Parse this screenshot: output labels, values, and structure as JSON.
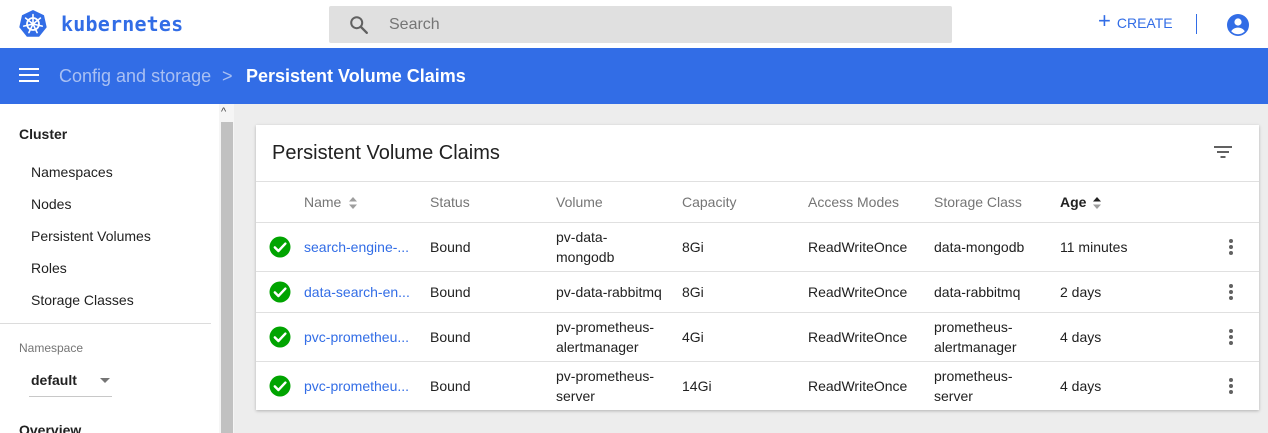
{
  "app": {
    "name": "kubernetes",
    "brand_color": "#326de6"
  },
  "search": {
    "placeholder": "Search"
  },
  "topbar": {
    "create_label": "CREATE"
  },
  "breadcrumb": {
    "parent": "Config and storage",
    "separator": ">",
    "current": "Persistent Volume Claims"
  },
  "sidebar": {
    "section": "Cluster",
    "items": [
      {
        "label": "Namespaces"
      },
      {
        "label": "Nodes"
      },
      {
        "label": "Persistent Volumes"
      },
      {
        "label": "Roles"
      },
      {
        "label": "Storage Classes"
      }
    ],
    "namespace_label": "Namespace",
    "namespace_value": "default",
    "overview_label": "Overview"
  },
  "card": {
    "title": "Persistent Volume Claims",
    "columns": [
      "Name",
      "Status",
      "Volume",
      "Capacity",
      "Access Modes",
      "Storage Class",
      "Age"
    ],
    "sorted_column": "Age",
    "rows": [
      {
        "name": "search-engine-...",
        "status": "Bound",
        "volume": [
          "pv-data-",
          "mongodb"
        ],
        "capacity": "8Gi",
        "access_modes": "ReadWriteOnce",
        "storage_class": [
          "data-mongodb"
        ],
        "age": "11 minutes",
        "status_color": "#00a400"
      },
      {
        "name": "data-search-en...",
        "status": "Bound",
        "volume": [
          "pv-data-rabbitmq"
        ],
        "capacity": "8Gi",
        "access_modes": "ReadWriteOnce",
        "storage_class": [
          "data-rabbitmq"
        ],
        "age": "2 days",
        "status_color": "#00a400"
      },
      {
        "name": "pvc-prometheu...",
        "status": "Bound",
        "volume": [
          "pv-prometheus-",
          "alertmanager"
        ],
        "capacity": "4Gi",
        "access_modes": "ReadWriteOnce",
        "storage_class": [
          "prometheus-",
          "alertmanager"
        ],
        "age": "4 days",
        "status_color": "#00a400"
      },
      {
        "name": "pvc-prometheu...",
        "status": "Bound",
        "volume": [
          "pv-prometheus-",
          "server"
        ],
        "capacity": "14Gi",
        "access_modes": "ReadWriteOnce",
        "storage_class": [
          "prometheus-",
          "server"
        ],
        "age": "4 days",
        "status_color": "#00a400"
      }
    ]
  }
}
